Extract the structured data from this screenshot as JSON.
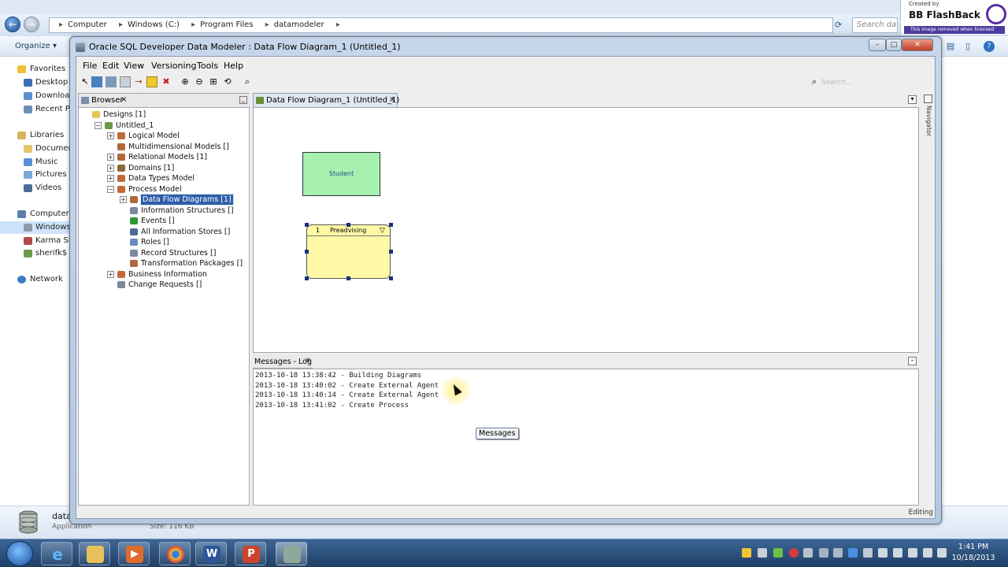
{
  "explorer": {
    "breadcrumb": [
      "Computer",
      "Windows (C:)",
      "Program Files",
      "datamodeler"
    ],
    "search_placeholder": "Search datam",
    "organize_label": "Organize ▾",
    "nav": {
      "favorites": "Favorites",
      "desktop": "Desktop",
      "downloads": "Download",
      "recent": "Recent Pla",
      "libraries": "Libraries",
      "documents": "Document",
      "music": "Music",
      "pictures": "Pictures",
      "videos": "Videos",
      "computer": "Computer",
      "windows": "Windows",
      "karma": "Karma She",
      "sherif": "sherifk$ (\\",
      "network": "Network"
    },
    "details": {
      "name": "datam",
      "type": "Application",
      "size": "Size: 116 KB"
    }
  },
  "watermark": {
    "created_by": "Created by",
    "brand": "BB FlashBack",
    "notice": "This image removed when licensed"
  },
  "window": {
    "title": "Oracle SQL Developer Data Modeler : Data Flow Diagram_1 (Untitled_1)",
    "menu": [
      "File",
      "Edit",
      "View",
      "Versioning",
      "Tools",
      "Help"
    ],
    "search_placeholder": "Search..."
  },
  "browser": {
    "tab_label": "Browser",
    "tree": [
      {
        "label": "Designs [1]",
        "level": 0,
        "expander": "",
        "icon": "folder"
      },
      {
        "label": "Untitled_1",
        "level": 1,
        "expander": "−",
        "icon": "design"
      },
      {
        "label": "Logical Model",
        "level": 2,
        "expander": "+",
        "icon": "model"
      },
      {
        "label": "Multidimensional Models []",
        "level": 2,
        "expander": "",
        "icon": "grid"
      },
      {
        "label": "Relational Models [1]",
        "level": 2,
        "expander": "+",
        "icon": "grid"
      },
      {
        "label": "Domains [1]",
        "level": 2,
        "expander": "+",
        "icon": "domain"
      },
      {
        "label": "Data Types Model",
        "level": 2,
        "expander": "+",
        "icon": "model"
      },
      {
        "label": "Process Model",
        "level": 2,
        "expander": "−",
        "icon": "model"
      },
      {
        "label": "Data Flow Diagrams [1]",
        "level": 3,
        "expander": "+",
        "icon": "grid",
        "selected": true
      },
      {
        "label": "Information Structures []",
        "level": 3,
        "expander": "",
        "icon": "list"
      },
      {
        "label": "Events []",
        "level": 3,
        "expander": "",
        "icon": "flag"
      },
      {
        "label": "All Information Stores []",
        "level": 3,
        "expander": "",
        "icon": "store"
      },
      {
        "label": "Roles []",
        "level": 3,
        "expander": "",
        "icon": "role"
      },
      {
        "label": "Record Structures []",
        "level": 3,
        "expander": "",
        "icon": "list"
      },
      {
        "label": "Transformation Packages []",
        "level": 3,
        "expander": "",
        "icon": "grid"
      },
      {
        "label": "Business Information",
        "level": 2,
        "expander": "+",
        "icon": "model"
      },
      {
        "label": "Change Requests []",
        "level": 2,
        "expander": "",
        "icon": "list"
      }
    ]
  },
  "diagram": {
    "tab_label": "Data Flow Diagram_1 (Untitled_1)",
    "entity_label": "Student",
    "process_number": "1",
    "process_name": "Preadvising",
    "navigator_label": "Navigator"
  },
  "log": {
    "tab_label": "Messages - Log",
    "lines": [
      "2013-10-18 13:38:42 - Building Diagrams",
      "2013-10-18 13:40:02 - Create External Agent",
      "2013-10-18 13:40:14 - Create External Agent",
      "2013-10-18 13:41:02 - Create Process"
    ],
    "tooltip": "Messages"
  },
  "status": {
    "mode": "Editing"
  },
  "taskbar": {
    "time": "1:41 PM",
    "date": "10/18/2013"
  },
  "colors": {
    "entity_fill": "#a8f0b0",
    "process_fill": "#fff9a6",
    "selection": "#2f5ea8"
  }
}
